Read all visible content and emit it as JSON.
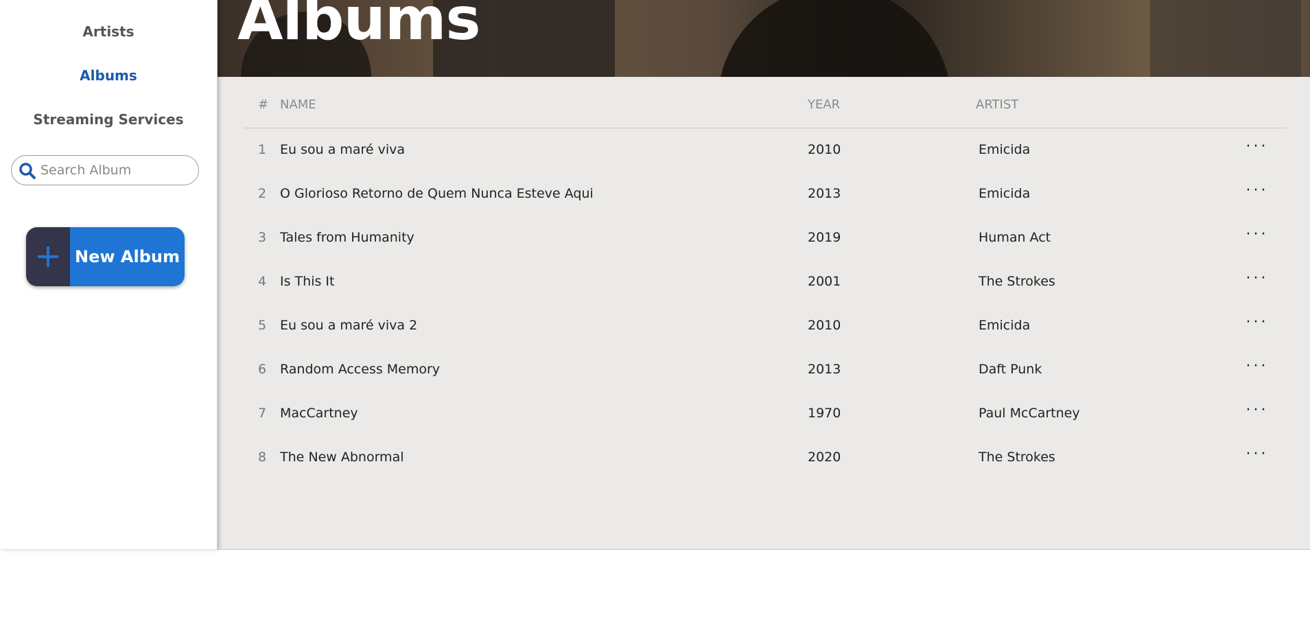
{
  "sidebar": {
    "nav": [
      {
        "label": "Artists",
        "active": false
      },
      {
        "label": "Albums",
        "active": true
      },
      {
        "label": "Streaming Services",
        "active": false
      }
    ],
    "search": {
      "placeholder": "Search Album",
      "value": "",
      "icon": "search-icon"
    },
    "new_album_button": {
      "label": "New Album",
      "icon": "plus-icon"
    }
  },
  "header": {
    "title": "Albums"
  },
  "table": {
    "columns": {
      "num": "#",
      "name": "NAME",
      "year": "YEAR",
      "artist": "ARTIST"
    },
    "rows": [
      {
        "num": "1",
        "name": "Eu sou a maré viva",
        "year": "2010",
        "artist": "Emicida"
      },
      {
        "num": "2",
        "name": "O Glorioso Retorno de Quem Nunca Esteve Aqui",
        "year": "2013",
        "artist": "Emicida"
      },
      {
        "num": "3",
        "name": "Tales from Humanity",
        "year": "2019",
        "artist": "Human Act"
      },
      {
        "num": "4",
        "name": "Is This It",
        "year": "2001",
        "artist": "The Strokes"
      },
      {
        "num": "5",
        "name": "Eu sou a maré viva 2",
        "year": "2010",
        "artist": "Emicida"
      },
      {
        "num": "6",
        "name": "Random Access Memory",
        "year": "2013",
        "artist": "Daft Punk"
      },
      {
        "num": "7",
        "name": "MacCartney",
        "year": "1970",
        "artist": "Paul McCartney"
      },
      {
        "num": "8",
        "name": "The New Abnormal",
        "year": "2020",
        "artist": "The Strokes"
      }
    ],
    "more_label": "···"
  },
  "colors": {
    "accent": "#1f75d4",
    "active_nav": "#1a5aa8",
    "button_dark": "#34344a"
  }
}
